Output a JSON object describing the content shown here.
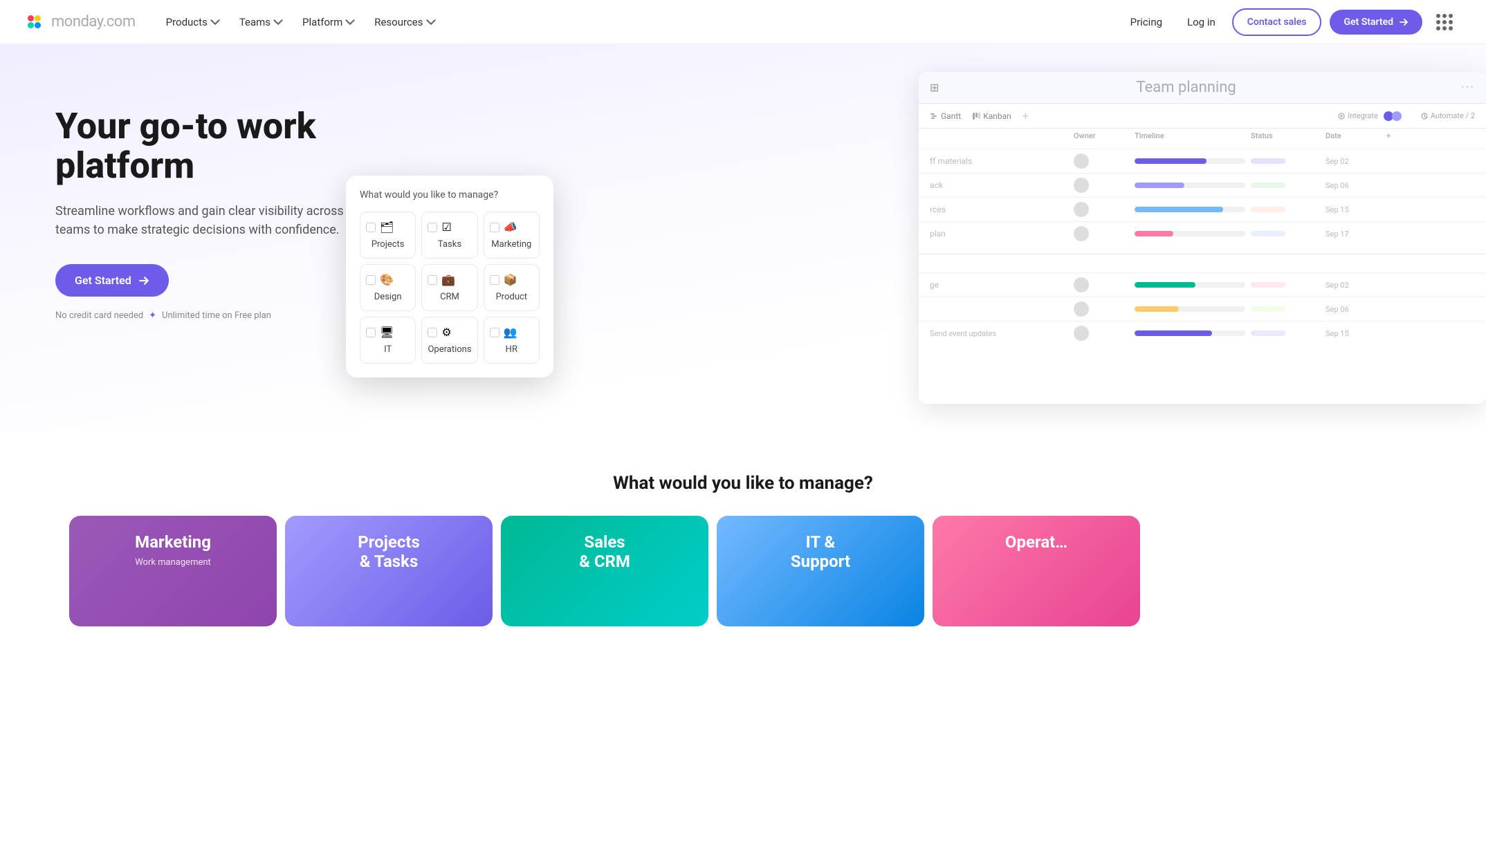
{
  "logo": {
    "text": "monday",
    "suffix": ".com"
  },
  "nav": {
    "links": [
      {
        "id": "products",
        "label": "Products",
        "hasDropdown": true
      },
      {
        "id": "teams",
        "label": "Teams",
        "hasDropdown": true
      },
      {
        "id": "platform",
        "label": "Platform",
        "hasDropdown": true
      },
      {
        "id": "resources",
        "label": "Resources",
        "hasDropdown": true
      }
    ],
    "pricing": "Pricing",
    "login": "Log in",
    "contact_sales": "Contact sales",
    "get_started": "Get Started"
  },
  "hero": {
    "title": "Your go-to work platform",
    "subtitle": "Streamline workflows and gain clear visibility across teams to make strategic decisions with confidence.",
    "cta": "Get Started",
    "footnote_1": "No credit card needed",
    "footnote_2": "Unlimited time on Free plan"
  },
  "dashboard": {
    "title": "Team planning",
    "tabs": [
      "Gantt",
      "Kanban"
    ],
    "integrate": "Integrate",
    "automate": "Automate / 2",
    "columns": [
      "",
      "Owner",
      "Timeline",
      "Status",
      "Date",
      "+"
    ],
    "section1": "",
    "rows1": [
      {
        "label": "ff materials",
        "date": "Sep 02"
      },
      {
        "label": "ack",
        "date": "Sep 06"
      },
      {
        "label": "rces",
        "date": "Sep 15"
      },
      {
        "label": "plan",
        "date": "Sep 17"
      }
    ],
    "section2": "",
    "rows2": [
      {
        "label": "ge",
        "date": "Sep 02"
      },
      {
        "label": "",
        "date": "Sep 06"
      },
      {
        "label": "Send event updates",
        "date": "Sep 15"
      }
    ],
    "bars": [
      {
        "width": "65%",
        "color": "#6c5ce7"
      },
      {
        "width": "45%",
        "color": "#a29bfe"
      },
      {
        "width": "80%",
        "color": "#74b9ff"
      },
      {
        "width": "35%",
        "color": "#fd79a8"
      },
      {
        "width": "55%",
        "color": "#00b894"
      },
      {
        "width": "40%",
        "color": "#fdcb6e"
      },
      {
        "width": "70%",
        "color": "#6c5ce7"
      }
    ]
  },
  "modal": {
    "title": "What would you like to manage?",
    "items": [
      {
        "id": "projects",
        "icon": "🗂",
        "label": "Projects"
      },
      {
        "id": "tasks",
        "icon": "☑",
        "label": "Tasks"
      },
      {
        "id": "marketing",
        "icon": "📣",
        "label": "Marketing"
      },
      {
        "id": "design",
        "icon": "🎨",
        "label": "Design"
      },
      {
        "id": "crm",
        "icon": "💼",
        "label": "CRM"
      },
      {
        "id": "product",
        "icon": "📦",
        "label": "Product"
      },
      {
        "id": "it",
        "icon": "🖥",
        "label": "IT"
      },
      {
        "id": "operations",
        "icon": "⚙",
        "label": "Operations"
      },
      {
        "id": "hr",
        "icon": "👥",
        "label": "HR"
      }
    ]
  },
  "what_section": {
    "title": "What would you like to manage?"
  },
  "bottom_cards": [
    {
      "id": "marketing",
      "title": "Marketing",
      "sub": "Work management",
      "class": "card-marketing"
    },
    {
      "id": "projects",
      "title": "Projects\n& Tasks",
      "sub": "",
      "class": "card-projects"
    },
    {
      "id": "sales",
      "title": "Sales\n& CRM",
      "sub": "",
      "class": "card-sales"
    },
    {
      "id": "it",
      "title": "IT &\nSupport",
      "sub": "",
      "class": "card-it"
    },
    {
      "id": "operations",
      "title": "Operat…",
      "sub": "",
      "class": "card-operations"
    }
  ]
}
